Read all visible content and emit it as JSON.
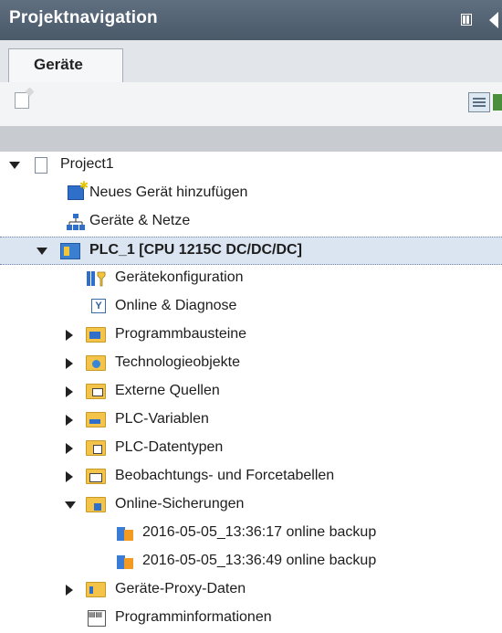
{
  "panel": {
    "title": "Projektnavigation"
  },
  "tabs": [
    {
      "label": "Geräte"
    }
  ],
  "tree": {
    "items": [
      {
        "label": "Project1",
        "icon": "project-icon",
        "expand": "down"
      },
      {
        "label": "Neues Gerät hinzufügen",
        "icon": "add-device-icon",
        "expand": "none"
      },
      {
        "label": "Geräte & Netze",
        "icon": "network-icon",
        "expand": "none"
      },
      {
        "label": "PLC_1 [CPU 1215C DC/DC/DC]",
        "icon": "plc-icon",
        "expand": "down"
      },
      {
        "label": "Gerätekonfiguration",
        "icon": "device-config-icon",
        "expand": "none"
      },
      {
        "label": "Online & Diagnose",
        "icon": "online-diagnostics-icon",
        "expand": "none"
      },
      {
        "label": "Programmbausteine",
        "icon": "program-blocks-folder-icon",
        "expand": "right"
      },
      {
        "label": "Technologieobjekte",
        "icon": "technology-objects-folder-icon",
        "expand": "right"
      },
      {
        "label": "Externe Quellen",
        "icon": "external-sources-folder-icon",
        "expand": "right"
      },
      {
        "label": "PLC-Variablen",
        "icon": "plc-tags-folder-icon",
        "expand": "right"
      },
      {
        "label": "PLC-Datentypen",
        "icon": "plc-datatypes-folder-icon",
        "expand": "right"
      },
      {
        "label": "Beobachtungs- und Forcetabellen",
        "icon": "watch-force-tables-folder-icon",
        "expand": "right"
      },
      {
        "label": "Online-Sicherungen",
        "icon": "online-backups-folder-icon",
        "expand": "down"
      },
      {
        "label": "2016-05-05_13:36:17 online backup",
        "icon": "backup-icon",
        "expand": "none"
      },
      {
        "label": "2016-05-05_13:36:49 online backup",
        "icon": "backup-icon",
        "expand": "none"
      },
      {
        "label": "Geräte-Proxy-Daten",
        "icon": "device-proxy-folder-icon",
        "expand": "right"
      },
      {
        "label": "Programminformationen",
        "icon": "program-info-icon",
        "expand": "none"
      }
    ]
  },
  "colors": {
    "title_bar": "#56667a",
    "selection": "#dbe5f1",
    "folder": "#f4c44a"
  }
}
